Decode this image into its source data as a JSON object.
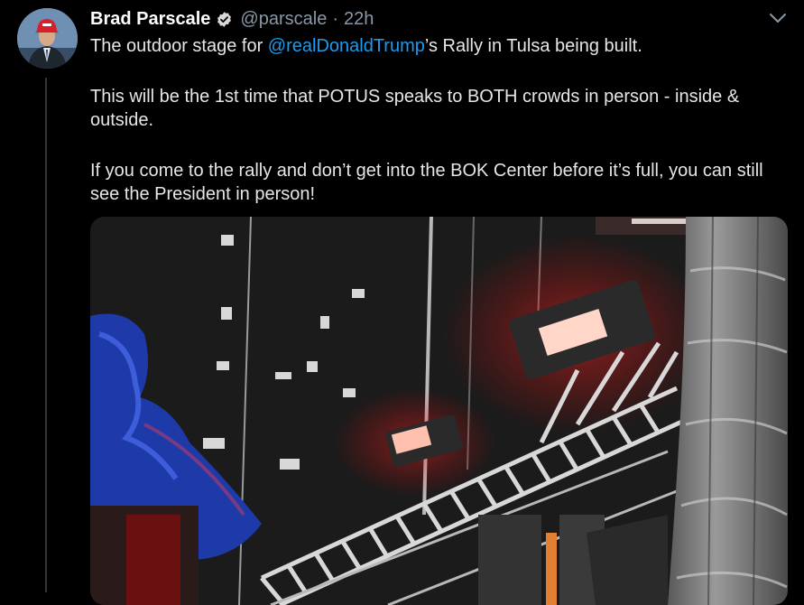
{
  "tweet": {
    "author_name": "Brad Parscale",
    "handle": "@parscale",
    "separator": "·",
    "time": "22h",
    "line1_before": "The outdoor stage for ",
    "line1_mention": "@realDonaldTrump",
    "line1_after": "’s Rally in Tulsa being built.",
    "para2": "This will be the 1st time that POTUS speaks to BOTH crowds in person - inside & outside.",
    "para3": "If you come to the rally and don’t get into the BOK Center before it’s full, you can still see the President in person!"
  },
  "icons": {
    "verified": "verified-badge-icon",
    "more": "chevron-down-icon"
  },
  "colors": {
    "background": "#000000",
    "link": "#1d9bf0",
    "muted": "#8b98a5",
    "verified": "#d9d9d9"
  }
}
